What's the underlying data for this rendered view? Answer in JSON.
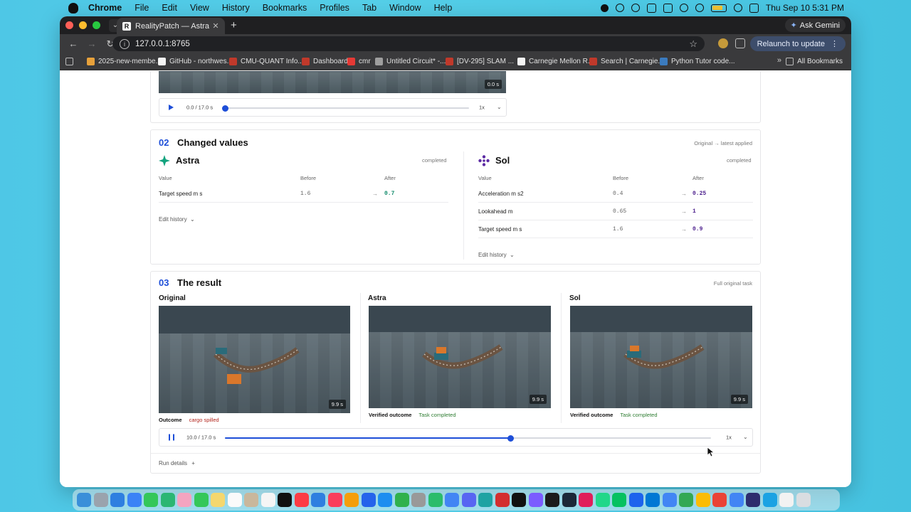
{
  "menubar": {
    "app": "Chrome",
    "items": [
      "File",
      "Edit",
      "View",
      "History",
      "Bookmarks",
      "Profiles",
      "Tab",
      "Window",
      "Help"
    ],
    "clock": "Thu Sep 10  5:31 PM"
  },
  "browser": {
    "tab_title": "RealityPatch — Astra and Sol",
    "tab_favicon": "R",
    "ask_gemini": "Ask Gemini",
    "url": "127.0.0.1:8765",
    "relaunch": "Relaunch to update",
    "bookmarks": [
      {
        "label": "2025-new-membe...",
        "color": "#e7a13b"
      },
      {
        "label": "GitHub - northwes...",
        "color": "#f5f5f5"
      },
      {
        "label": "CMU-QUANT Info...",
        "color": "#c0392b"
      },
      {
        "label": "Dashboard",
        "color": "#c0392b"
      },
      {
        "label": "cmr",
        "color": "#e53935"
      },
      {
        "label": "Untitled Circuit* -...",
        "color": "#9e9e9e"
      },
      {
        "label": "[DV-295] SLAM ...",
        "color": "#c0392b"
      },
      {
        "label": "Carnegie Mellon R...",
        "color": "#f5f5f5"
      },
      {
        "label": "Search | Carnegie...",
        "color": "#c0392b"
      },
      {
        "label": "Python Tutor code...",
        "color": "#3b7bbf"
      }
    ],
    "all_bookmarks": "All Bookmarks"
  },
  "top_player": {
    "time": "0.0 / 17.0 s",
    "speed": "1x",
    "progress": 0,
    "viewer_time": "0.0 s"
  },
  "changed_values": {
    "num": "02",
    "title": "Changed values",
    "note": "Original → latest applied",
    "models": [
      {
        "name": "Astra",
        "status": "completed",
        "color": "#0f8a6a",
        "headers": {
          "value": "Value",
          "before": "Before",
          "after": "After"
        },
        "rows": [
          {
            "label": "Target speed m s",
            "before": "1.6",
            "arrow": "→",
            "after": "0.7"
          }
        ],
        "edit_history": "Edit history"
      },
      {
        "name": "Sol",
        "status": "completed",
        "color": "#4b1d8c",
        "headers": {
          "value": "Value",
          "before": "Before",
          "after": "After"
        },
        "rows": [
          {
            "label": "Acceleration m s2",
            "before": "0.4",
            "arrow": "→",
            "after": "0.25"
          },
          {
            "label": "Lookahead m",
            "before": "0.65",
            "arrow": "→",
            "after": "1"
          },
          {
            "label": "Target speed m s",
            "before": "1.6",
            "arrow": "→",
            "after": "0.9"
          }
        ],
        "edit_history": "Edit history"
      }
    ]
  },
  "result": {
    "num": "03",
    "title": "The result",
    "note": "Full original task",
    "columns": [
      {
        "title": "Original",
        "time": "9.9 s",
        "outcome_label": "Outcome",
        "outcome_value": "cargo spilled",
        "status": "bad"
      },
      {
        "title": "Astra",
        "time": "9.9 s",
        "outcome_label": "Verified outcome",
        "outcome_value": "Task completed",
        "status": "good"
      },
      {
        "title": "Sol",
        "time": "9.9 s",
        "outcome_label": "Verified outcome",
        "outcome_value": "Task completed",
        "status": "good"
      }
    ],
    "player": {
      "time": "10.0 / 17.0 s",
      "speed": "1x",
      "progress": 0.588
    },
    "run_details": "Run details",
    "run_details_icon": "+"
  },
  "colors": {
    "accent": "#1d4ed8",
    "astra": "#0f8a6a",
    "sol": "#4b1d8c",
    "bad": "#b3261e",
    "good": "#2e7d32"
  }
}
